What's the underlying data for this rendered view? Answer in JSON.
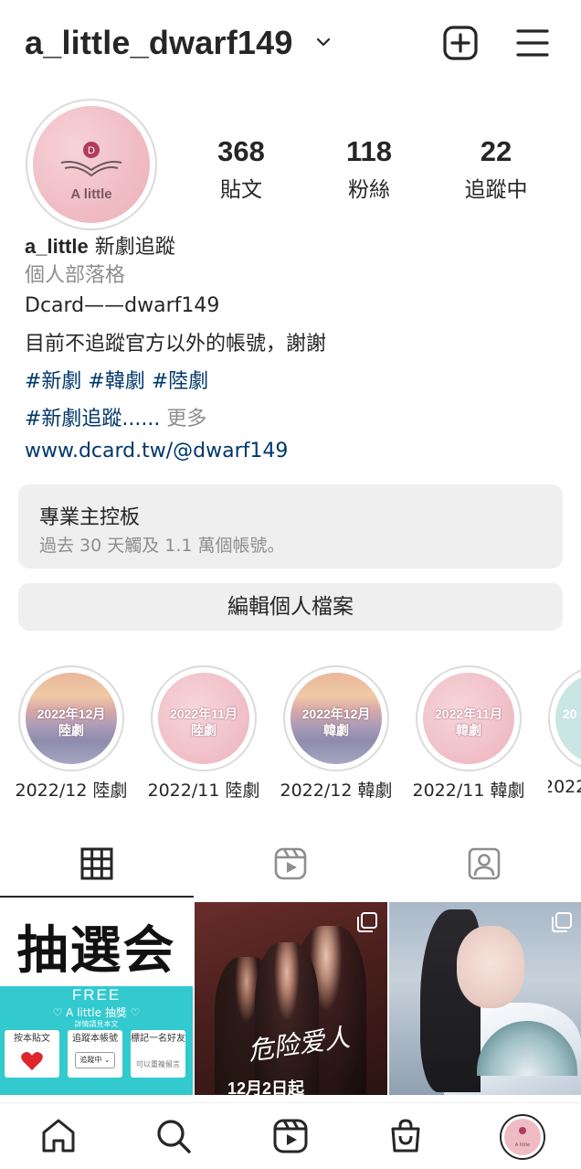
{
  "header": {
    "username": "a_little_dwarf149"
  },
  "profile": {
    "avatar_text": "A little",
    "avatar_letter": "D",
    "stats": [
      {
        "value": "368",
        "label": "貼文"
      },
      {
        "value": "118",
        "label": "粉絲"
      },
      {
        "value": "22",
        "label": "追蹤中"
      }
    ],
    "name": "a_little",
    "name_suffix": " 新劇追蹤",
    "category": "個人部落格",
    "bio_lines": [
      "Dcard——dwarf149",
      "目前不追蹤官方以外的帳號，謝謝"
    ],
    "hashtags": "#新劇 #韓劇 #陸劇",
    "hashtags2": "#新劇追蹤......",
    "more": " 更多",
    "link": "www.dcard.tw/@dwarf149"
  },
  "dashboard": {
    "title": "專業主控板",
    "subtitle": "過去 30 天觸及 1.1 萬個帳號。"
  },
  "edit_profile": "編輯個人檔案",
  "highlights": [
    {
      "label": "2022/12 陸劇",
      "cover_line1": "2022年12月",
      "cover_line2": "陸劇",
      "style": "cloud"
    },
    {
      "label": "2022/11 陸劇",
      "cover_line1": "2022年11月",
      "cover_line2": "陸劇",
      "style": "pink"
    },
    {
      "label": "2022/12 韓劇",
      "cover_line1": "2022年12月",
      "cover_line2": "韓劇",
      "style": "cloud"
    },
    {
      "label": "2022/11 韓劇",
      "cover_line1": "2022年11月",
      "cover_line2": "韓劇",
      "style": "pink"
    },
    {
      "label": "2022",
      "cover_line1": "20",
      "cover_line2": "",
      "style": "mint"
    }
  ],
  "tabs": [
    {
      "icon": "grid-icon",
      "active": true
    },
    {
      "icon": "reels-icon",
      "active": false
    },
    {
      "icon": "tagged-icon",
      "active": false
    }
  ],
  "posts": {
    "post1": {
      "big": "抽選会",
      "free": "FREE",
      "sub": "♡ A little 抽獎 ♡",
      "note": "詳情請見本文",
      "box1": "按本貼文",
      "box2": "追蹤本帳號",
      "box2_pill": "追蹤中 ⌄",
      "box3": "標記一名好友",
      "box3_small": "可以重複留言"
    },
    "post2": {
      "title": "危险爱人",
      "date": "12月2日起"
    }
  },
  "bottom_nav": [
    {
      "icon": "home-icon"
    },
    {
      "icon": "search-icon"
    },
    {
      "icon": "reels-icon"
    },
    {
      "icon": "shop-icon"
    },
    {
      "icon": "profile-avatar"
    }
  ],
  "colors": {
    "link": "#00376b",
    "secondary": "#8e8e8e",
    "button_bg": "#efefef",
    "text": "#262626"
  }
}
